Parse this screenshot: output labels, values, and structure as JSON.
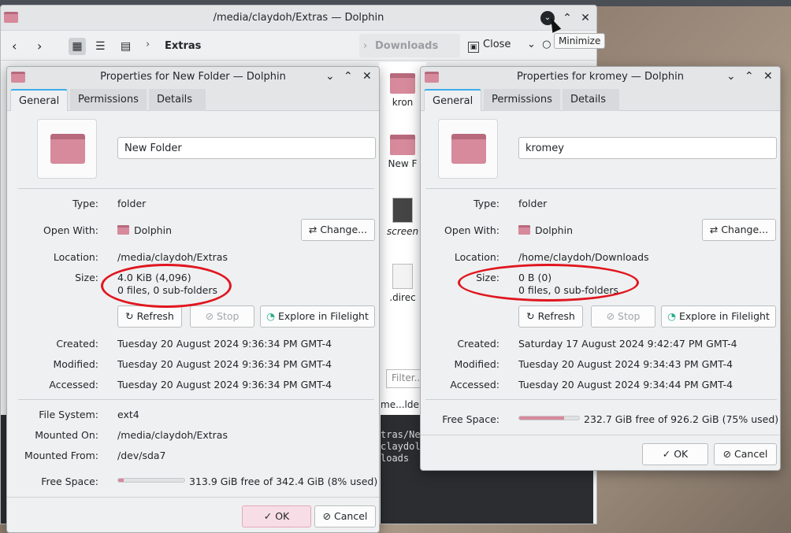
{
  "main_window": {
    "title": "/media/claydoh/Extras — Dolphin",
    "tooltip": "Minimize",
    "breadcrumb": "Extras",
    "split_breadcrumb": "Downloads",
    "close_label": "Close",
    "files": [
      {
        "name": "kron",
        "kind": "folder"
      },
      {
        "name": "New F",
        "kind": "folder"
      },
      {
        "name": "screen",
        "kind": "image"
      },
      {
        "name": ".direc",
        "kind": "file"
      }
    ],
    "filter_placeholder": "Filter...",
    "status_text": "me...lder",
    "terminal_lines": [
      "tras/Ne",
      "claydol",
      "loads"
    ]
  },
  "dialog1": {
    "title": "Properties for New Folder — Dolphin",
    "tabs": [
      "General",
      "Permissions",
      "Details"
    ],
    "name": "New Folder",
    "labels": {
      "type": "Type:",
      "open_with": "Open With:",
      "location": "Location:",
      "size": "Size:",
      "created": "Created:",
      "modified": "Modified:",
      "accessed": "Accessed:",
      "file_system": "File System:",
      "mounted_on": "Mounted On:",
      "mounted_from": "Mounted From:",
      "free_space": "Free Space:"
    },
    "type": "folder",
    "open_with": "Dolphin",
    "change_label": "Change...",
    "location": "/media/claydoh/Extras",
    "size": "4.0 KiB (4,096)",
    "contents": "0 files, 0 sub-folders",
    "refresh_label": "Refresh",
    "stop_label": "Stop",
    "filelight_label": "Explore in Filelight",
    "created": "Tuesday 20 August 2024 9:36:34 PM GMT-4",
    "modified": "Tuesday 20 August 2024 9:36:34 PM GMT-4",
    "accessed": "Tuesday 20 August 2024 9:36:34 PM GMT-4",
    "file_system": "ext4",
    "mounted_on": "/media/claydoh/Extras",
    "mounted_from": "/dev/sda7",
    "free_space": "313.9 GiB free of 342.4 GiB (8% used)",
    "used_fraction": 0.08,
    "ok_label": "OK",
    "cancel_label": "Cancel"
  },
  "dialog2": {
    "title": "Properties for kromey — Dolphin",
    "tabs": [
      "General",
      "Permissions",
      "Details"
    ],
    "name": "kromey",
    "labels": {
      "type": "Type:",
      "open_with": "Open With:",
      "location": "Location:",
      "size": "Size:",
      "created": "Created:",
      "modified": "Modified:",
      "accessed": "Accessed:",
      "free_space": "Free Space:"
    },
    "type": "folder",
    "open_with": "Dolphin",
    "change_label": "Change...",
    "location": "/home/claydoh/Downloads",
    "size": "0 B (0)",
    "contents": "0 files, 0 sub-folders",
    "refresh_label": "Refresh",
    "stop_label": "Stop",
    "filelight_label": "Explore in Filelight",
    "created": "Saturday 17 August 2024 9:42:47 PM GMT-4",
    "modified": "Tuesday 20 August 2024 9:34:43 PM GMT-4",
    "accessed": "Tuesday 20 August 2024 9:34:44 PM GMT-4",
    "free_space": "232.7 GiB free of 926.2 GiB (75% used)",
    "used_fraction": 0.75,
    "ok_label": "OK",
    "cancel_label": "Cancel"
  },
  "colors": {
    "accent": "#3daee9",
    "folder": "#d68a9c",
    "annotation": "#e0161f"
  }
}
